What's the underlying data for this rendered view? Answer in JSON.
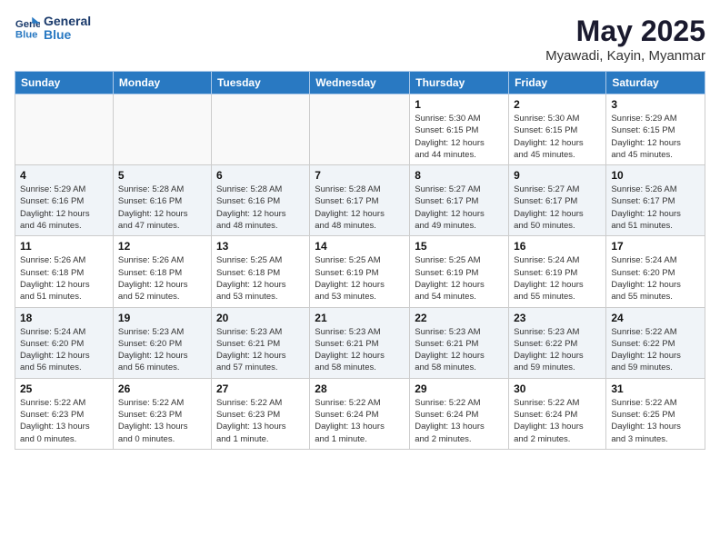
{
  "header": {
    "logo_line1": "General",
    "logo_line2": "Blue",
    "month": "May 2025",
    "location": "Myawadi, Kayin, Myanmar"
  },
  "weekdays": [
    "Sunday",
    "Monday",
    "Tuesday",
    "Wednesday",
    "Thursday",
    "Friday",
    "Saturday"
  ],
  "weeks": [
    [
      {
        "day": "",
        "info": ""
      },
      {
        "day": "",
        "info": ""
      },
      {
        "day": "",
        "info": ""
      },
      {
        "day": "",
        "info": ""
      },
      {
        "day": "1",
        "info": "Sunrise: 5:30 AM\nSunset: 6:15 PM\nDaylight: 12 hours\nand 44 minutes."
      },
      {
        "day": "2",
        "info": "Sunrise: 5:30 AM\nSunset: 6:15 PM\nDaylight: 12 hours\nand 45 minutes."
      },
      {
        "day": "3",
        "info": "Sunrise: 5:29 AM\nSunset: 6:15 PM\nDaylight: 12 hours\nand 45 minutes."
      }
    ],
    [
      {
        "day": "4",
        "info": "Sunrise: 5:29 AM\nSunset: 6:16 PM\nDaylight: 12 hours\nand 46 minutes."
      },
      {
        "day": "5",
        "info": "Sunrise: 5:28 AM\nSunset: 6:16 PM\nDaylight: 12 hours\nand 47 minutes."
      },
      {
        "day": "6",
        "info": "Sunrise: 5:28 AM\nSunset: 6:16 PM\nDaylight: 12 hours\nand 48 minutes."
      },
      {
        "day": "7",
        "info": "Sunrise: 5:28 AM\nSunset: 6:17 PM\nDaylight: 12 hours\nand 48 minutes."
      },
      {
        "day": "8",
        "info": "Sunrise: 5:27 AM\nSunset: 6:17 PM\nDaylight: 12 hours\nand 49 minutes."
      },
      {
        "day": "9",
        "info": "Sunrise: 5:27 AM\nSunset: 6:17 PM\nDaylight: 12 hours\nand 50 minutes."
      },
      {
        "day": "10",
        "info": "Sunrise: 5:26 AM\nSunset: 6:17 PM\nDaylight: 12 hours\nand 51 minutes."
      }
    ],
    [
      {
        "day": "11",
        "info": "Sunrise: 5:26 AM\nSunset: 6:18 PM\nDaylight: 12 hours\nand 51 minutes."
      },
      {
        "day": "12",
        "info": "Sunrise: 5:26 AM\nSunset: 6:18 PM\nDaylight: 12 hours\nand 52 minutes."
      },
      {
        "day": "13",
        "info": "Sunrise: 5:25 AM\nSunset: 6:18 PM\nDaylight: 12 hours\nand 53 minutes."
      },
      {
        "day": "14",
        "info": "Sunrise: 5:25 AM\nSunset: 6:19 PM\nDaylight: 12 hours\nand 53 minutes."
      },
      {
        "day": "15",
        "info": "Sunrise: 5:25 AM\nSunset: 6:19 PM\nDaylight: 12 hours\nand 54 minutes."
      },
      {
        "day": "16",
        "info": "Sunrise: 5:24 AM\nSunset: 6:19 PM\nDaylight: 12 hours\nand 55 minutes."
      },
      {
        "day": "17",
        "info": "Sunrise: 5:24 AM\nSunset: 6:20 PM\nDaylight: 12 hours\nand 55 minutes."
      }
    ],
    [
      {
        "day": "18",
        "info": "Sunrise: 5:24 AM\nSunset: 6:20 PM\nDaylight: 12 hours\nand 56 minutes."
      },
      {
        "day": "19",
        "info": "Sunrise: 5:23 AM\nSunset: 6:20 PM\nDaylight: 12 hours\nand 56 minutes."
      },
      {
        "day": "20",
        "info": "Sunrise: 5:23 AM\nSunset: 6:21 PM\nDaylight: 12 hours\nand 57 minutes."
      },
      {
        "day": "21",
        "info": "Sunrise: 5:23 AM\nSunset: 6:21 PM\nDaylight: 12 hours\nand 58 minutes."
      },
      {
        "day": "22",
        "info": "Sunrise: 5:23 AM\nSunset: 6:21 PM\nDaylight: 12 hours\nand 58 minutes."
      },
      {
        "day": "23",
        "info": "Sunrise: 5:23 AM\nSunset: 6:22 PM\nDaylight: 12 hours\nand 59 minutes."
      },
      {
        "day": "24",
        "info": "Sunrise: 5:22 AM\nSunset: 6:22 PM\nDaylight: 12 hours\nand 59 minutes."
      }
    ],
    [
      {
        "day": "25",
        "info": "Sunrise: 5:22 AM\nSunset: 6:23 PM\nDaylight: 13 hours\nand 0 minutes."
      },
      {
        "day": "26",
        "info": "Sunrise: 5:22 AM\nSunset: 6:23 PM\nDaylight: 13 hours\nand 0 minutes."
      },
      {
        "day": "27",
        "info": "Sunrise: 5:22 AM\nSunset: 6:23 PM\nDaylight: 13 hours\nand 1 minute."
      },
      {
        "day": "28",
        "info": "Sunrise: 5:22 AM\nSunset: 6:24 PM\nDaylight: 13 hours\nand 1 minute."
      },
      {
        "day": "29",
        "info": "Sunrise: 5:22 AM\nSunset: 6:24 PM\nDaylight: 13 hours\nand 2 minutes."
      },
      {
        "day": "30",
        "info": "Sunrise: 5:22 AM\nSunset: 6:24 PM\nDaylight: 13 hours\nand 2 minutes."
      },
      {
        "day": "31",
        "info": "Sunrise: 5:22 AM\nSunset: 6:25 PM\nDaylight: 13 hours\nand 3 minutes."
      }
    ]
  ]
}
